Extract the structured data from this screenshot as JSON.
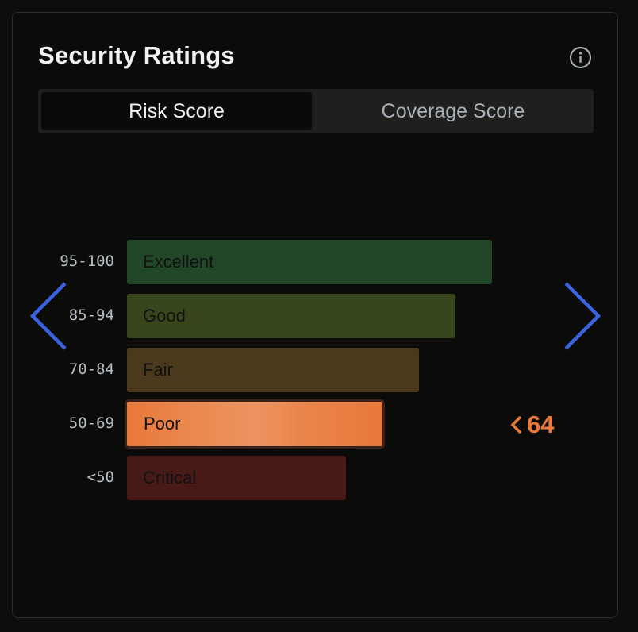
{
  "header": {
    "title": "Security Ratings",
    "info_icon": "info-circle-icon"
  },
  "tabs": [
    {
      "label": "Risk Score",
      "active": true
    },
    {
      "label": "Coverage Score",
      "active": false
    }
  ],
  "ratings": [
    {
      "range": "95-100",
      "label": "Excellent",
      "color": "#224628",
      "relative_length": 1.0,
      "highlighted": false
    },
    {
      "range": "85-94",
      "label": "Good",
      "color": "#37461b",
      "relative_length": 0.9,
      "highlighted": false
    },
    {
      "range": "70-84",
      "label": "Fair",
      "color": "#4a391c",
      "relative_length": 0.8,
      "highlighted": false
    },
    {
      "range": "50-69",
      "label": "Poor",
      "color": "#e8793a",
      "relative_length": 0.7,
      "highlighted": true
    },
    {
      "range": "<50",
      "label": "Critical",
      "color": "#471a17",
      "relative_length": 0.6,
      "highlighted": false
    }
  ],
  "current_score": {
    "value": "64",
    "color": "#e8793a",
    "pointer_icon": "chevron-left-icon"
  },
  "navigation": {
    "prev_icon": "chevron-left-icon",
    "next_icon": "chevron-right-icon",
    "color": "#3a63e0"
  },
  "colors": {
    "background": "#0d0d0c",
    "card_border": "#2c2c2b",
    "title": "#f2f2f2",
    "tab_track": "#1f1f1e",
    "tab_active": "#0a0a09"
  }
}
